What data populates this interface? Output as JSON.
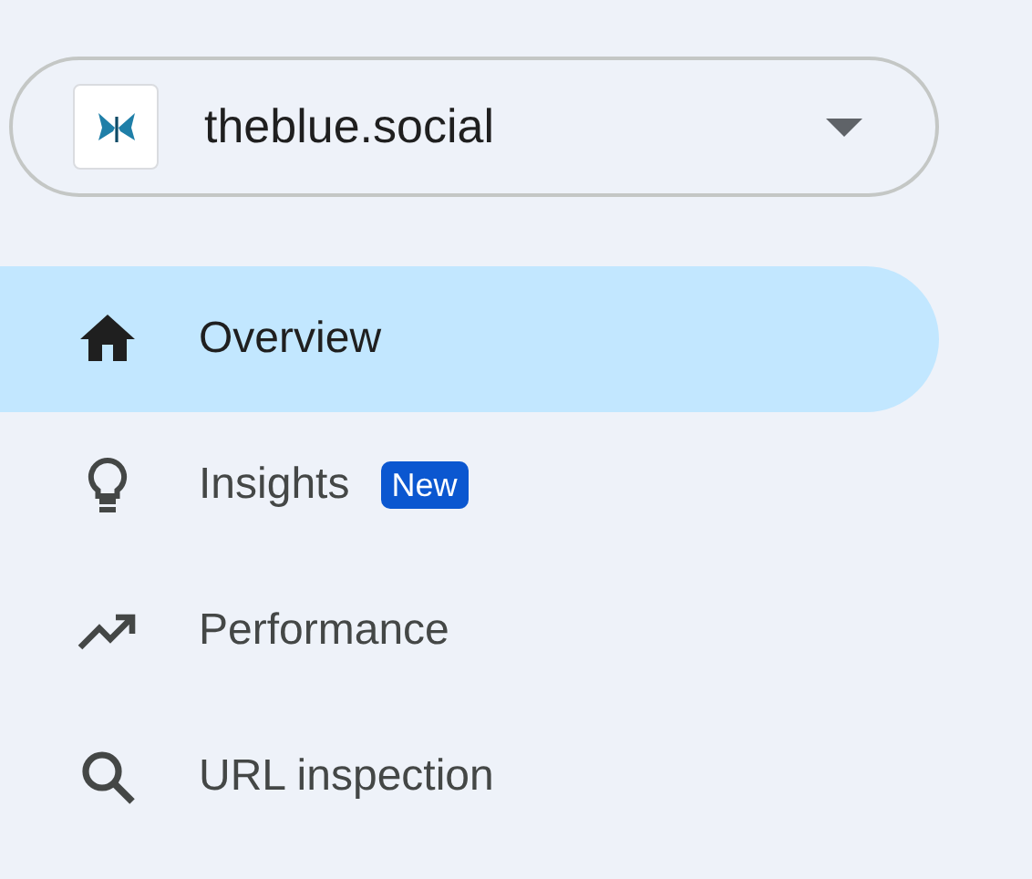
{
  "property_selector": {
    "name": "theblue.social"
  },
  "nav": [
    {
      "label": "Overview",
      "kind": "home",
      "selected": true
    },
    {
      "label": "Insights",
      "kind": "lightbulb",
      "selected": false,
      "badge": "New"
    },
    {
      "label": "Performance",
      "kind": "trend",
      "selected": false
    },
    {
      "label": "URL inspection",
      "kind": "search",
      "selected": false
    }
  ]
}
